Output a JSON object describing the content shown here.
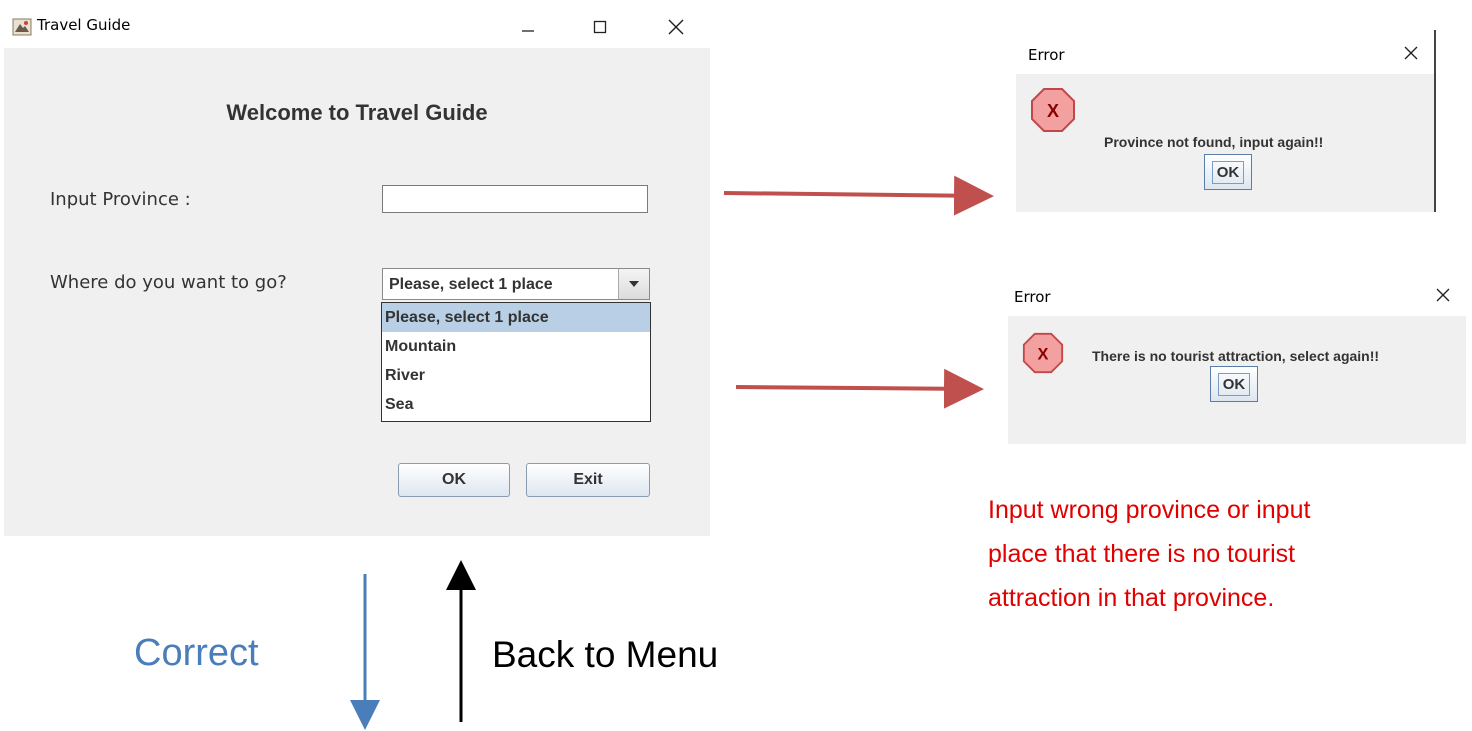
{
  "main_window": {
    "title": "Travel Guide",
    "heading": "Welcome to Travel Guide",
    "province_label": "Input Province :",
    "province_value": "",
    "where_label": "Where do you want to go?",
    "place_selected": "Please, select 1 place",
    "place_options": [
      "Please, select 1 place",
      "Mountain",
      "River",
      "Sea"
    ],
    "ok_label": "OK",
    "exit_label": "Exit"
  },
  "error_dialogs": [
    {
      "title": "Error",
      "message": "Province not found, input again!!",
      "ok_label": "OK"
    },
    {
      "title": "Error",
      "message": "There is no tourist attraction, select again!!",
      "ok_label": "OK"
    }
  ],
  "annotations": {
    "note_line_1": "Input wrong province or input",
    "note_line_2": "place that there is no tourist",
    "note_line_3": "attraction in that province.",
    "correct": "Correct",
    "back_to_menu": "Back to Menu"
  },
  "colors": {
    "note": "#e00000",
    "correct": "#4a7ebb",
    "arrow_red": "#c0504d",
    "arrow_blue": "#4a7ebb",
    "selected_option": "#b8cfe5"
  }
}
